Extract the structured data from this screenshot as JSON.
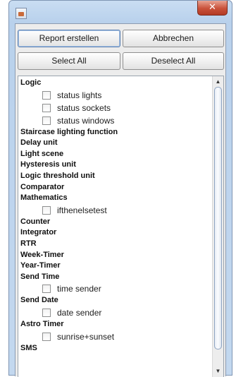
{
  "window": {
    "close_glyph": "✕",
    "app_icon": "java-app-icon"
  },
  "buttons": {
    "report": "Report erstellen",
    "cancel": "Abbrechen",
    "select_all": "Select All",
    "deselect_all": "Deselect All"
  },
  "tree": [
    {
      "label": "Logic",
      "children": [
        "status lights",
        "status sockets",
        "status windows"
      ]
    },
    {
      "label": "Staircase lighting function",
      "children": []
    },
    {
      "label": "Delay unit",
      "children": []
    },
    {
      "label": "Light scene",
      "children": []
    },
    {
      "label": "Hysteresis unit",
      "children": []
    },
    {
      "label": "Logic threshold unit",
      "children": []
    },
    {
      "label": "Comparator",
      "children": []
    },
    {
      "label": "Mathematics",
      "children": [
        "ifthenelsetest"
      ]
    },
    {
      "label": "Counter",
      "children": []
    },
    {
      "label": "Integrator",
      "children": []
    },
    {
      "label": "RTR",
      "children": []
    },
    {
      "label": "Week-Timer",
      "children": []
    },
    {
      "label": "Year-Timer",
      "children": []
    },
    {
      "label": "Send Time",
      "children": [
        "time sender"
      ]
    },
    {
      "label": "Send Date",
      "children": [
        "date sender"
      ]
    },
    {
      "label": "Astro Timer",
      "children": [
        "sunrise+sunset"
      ]
    },
    {
      "label": "SMS",
      "children": []
    }
  ],
  "scrollbar": {
    "up_glyph": "▲",
    "down_glyph": "▼"
  }
}
